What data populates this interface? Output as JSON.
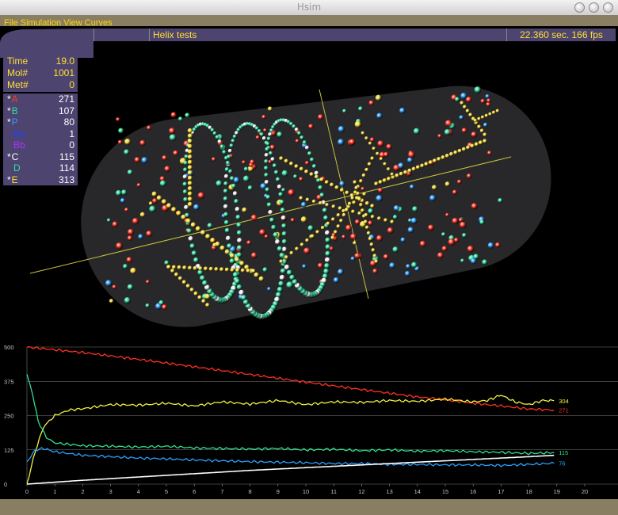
{
  "window": {
    "title": "Hsim"
  },
  "menu": [
    "File",
    "Simulation",
    "View",
    "Curves"
  ],
  "header": {
    "title": "Helix tests",
    "status": "22.360 sec. 166 fps"
  },
  "stats": [
    {
      "label": "Time",
      "value": "19.0"
    },
    {
      "label": "Mol#",
      "value": "1001"
    },
    {
      "label": "Met#",
      "value": "0"
    }
  ],
  "species": [
    {
      "star": "*",
      "label": "A",
      "value": "271",
      "color": "#ff3a20"
    },
    {
      "star": "*",
      "label": "B",
      "value": "107",
      "color": "#30e0a0"
    },
    {
      "star": "*",
      "label": "P",
      "value": "80",
      "color": "#2a9cff"
    },
    {
      "star": "",
      "label": "Ba",
      "value": "1",
      "color": "#2040ff"
    },
    {
      "star": "",
      "label": "Bb",
      "value": "0",
      "color": "#b030ff"
    },
    {
      "star": "*",
      "label": "C",
      "value": "115",
      "color": "#ffffff"
    },
    {
      "star": "",
      "label": "D",
      "value": "114",
      "color": "#30e0a0"
    },
    {
      "star": "*",
      "label": "E",
      "value": "313",
      "color": "#ffe030"
    }
  ],
  "chart_data": {
    "type": "line",
    "x_ticks": [
      "0",
      "1",
      "2",
      "3",
      "4",
      "5",
      "6",
      "7",
      "8",
      "9",
      "10",
      "11",
      "12",
      "13",
      "14",
      "15",
      "16",
      "17",
      "18",
      "19",
      "20"
    ],
    "y_ticks": [
      "0",
      "125",
      "250",
      "375",
      "500"
    ],
    "xlim": [
      0,
      20
    ],
    "ylim": [
      0,
      500
    ],
    "grid": "horizontal",
    "series": [
      {
        "color": "#ff3020",
        "end_label": "271",
        "points": [
          [
            0,
            500
          ],
          [
            2,
            480
          ],
          [
            4,
            455
          ],
          [
            6,
            428
          ],
          [
            8,
            400
          ],
          [
            10,
            372
          ],
          [
            12,
            345
          ],
          [
            14,
            318
          ],
          [
            15,
            308
          ],
          [
            16,
            295
          ],
          [
            17,
            285
          ],
          [
            18,
            274
          ],
          [
            18.9,
            270
          ]
        ]
      },
      {
        "color": "#f0f040",
        "end_label": "304",
        "points": [
          [
            0,
            0
          ],
          [
            0.3,
            120
          ],
          [
            0.6,
            210
          ],
          [
            1,
            250
          ],
          [
            1.5,
            270
          ],
          [
            2,
            275
          ],
          [
            3,
            290
          ],
          [
            4,
            288
          ],
          [
            5,
            295
          ],
          [
            6,
            285
          ],
          [
            7,
            300
          ],
          [
            8,
            292
          ],
          [
            9,
            305
          ],
          [
            10,
            290
          ],
          [
            11,
            300
          ],
          [
            12,
            298
          ],
          [
            13,
            305
          ],
          [
            14,
            302
          ],
          [
            15,
            310
          ],
          [
            16,
            300
          ],
          [
            16.5,
            305
          ],
          [
            17,
            325
          ],
          [
            17.5,
            300
          ],
          [
            18,
            290
          ],
          [
            18.5,
            305
          ],
          [
            18.9,
            304
          ]
        ]
      },
      {
        "color": "#30e090",
        "end_label": "115",
        "points": [
          [
            0,
            400
          ],
          [
            0.2,
            330
          ],
          [
            0.4,
            230
          ],
          [
            0.7,
            170
          ],
          [
            1,
            150
          ],
          [
            2,
            140
          ],
          [
            3,
            138
          ],
          [
            4,
            135
          ],
          [
            5,
            138
          ],
          [
            6,
            132
          ],
          [
            7,
            130
          ],
          [
            8,
            128
          ],
          [
            9,
            130
          ],
          [
            10,
            125
          ],
          [
            11,
            127
          ],
          [
            12,
            122
          ],
          [
            13,
            125
          ],
          [
            14,
            120
          ],
          [
            15,
            122
          ],
          [
            16,
            118
          ],
          [
            17,
            116
          ],
          [
            18,
            112
          ],
          [
            18.9,
            115
          ]
        ]
      },
      {
        "color": "#2aa0ff",
        "end_label": "76",
        "points": [
          [
            0,
            80
          ],
          [
            0.3,
            125
          ],
          [
            0.6,
            130
          ],
          [
            1,
            118
          ],
          [
            2,
            105
          ],
          [
            3,
            100
          ],
          [
            4,
            95
          ],
          [
            5,
            92
          ],
          [
            6,
            88
          ],
          [
            7,
            85
          ],
          [
            8,
            82
          ],
          [
            9,
            80
          ],
          [
            10,
            78
          ],
          [
            11,
            75
          ],
          [
            12,
            75
          ],
          [
            13,
            72
          ],
          [
            14,
            72
          ],
          [
            15,
            70
          ],
          [
            16,
            70
          ],
          [
            17,
            68
          ],
          [
            18,
            72
          ],
          [
            18.9,
            76
          ]
        ]
      },
      {
        "color": "#ffffff",
        "end_label": "",
        "points": [
          [
            0,
            0
          ],
          [
            2,
            14
          ],
          [
            4,
            26
          ],
          [
            6,
            38
          ],
          [
            8,
            50
          ],
          [
            10,
            60
          ],
          [
            12,
            70
          ],
          [
            14,
            80
          ],
          [
            16,
            90
          ],
          [
            18,
            100
          ],
          [
            18.9,
            105
          ]
        ]
      }
    ]
  }
}
